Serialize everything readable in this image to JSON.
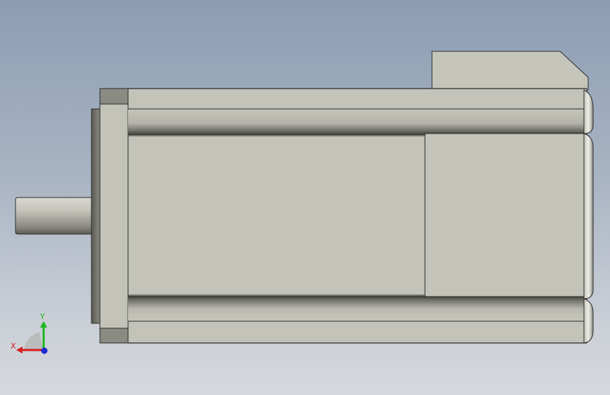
{
  "viewport": {
    "background_top": "#8c9db3",
    "background_bottom": "#d6d8dd"
  },
  "model": {
    "name": "servo-motor-side-view",
    "body_color": "#c3c3ba",
    "shadow_color": "#6a6a62",
    "edge_color": "#2a2a2a"
  },
  "triad": {
    "x_label": "X",
    "y_label": "Y",
    "x_color": "#d41e1e",
    "y_color": "#19b81e",
    "z_color": "#1e2ad4"
  }
}
